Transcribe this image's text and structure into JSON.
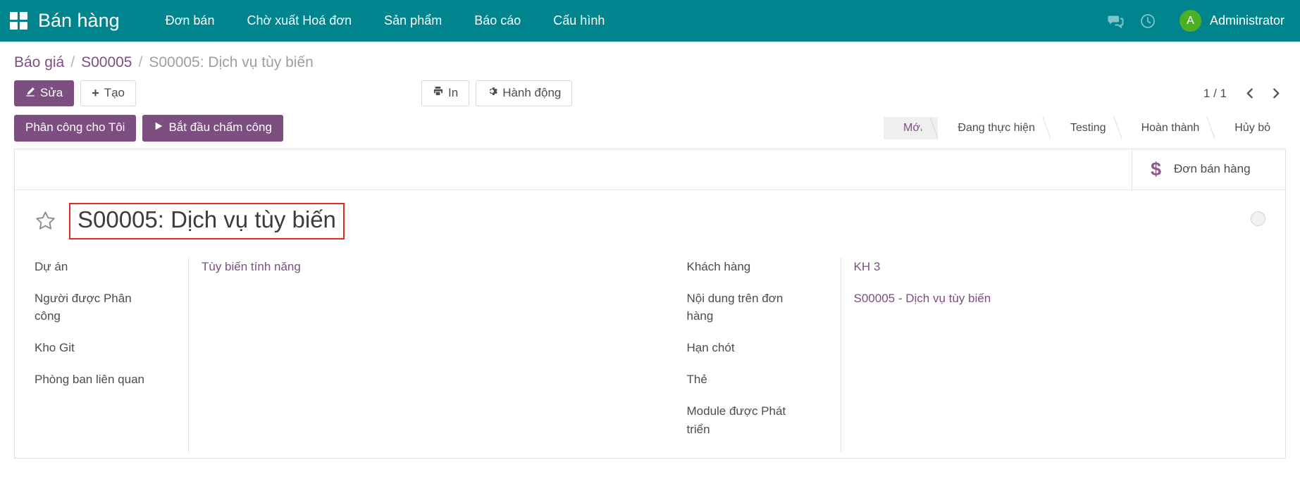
{
  "navbar": {
    "apps_icon": "apps-grid-icon",
    "brand": "Bán hàng",
    "menu": [
      {
        "label": "Đơn bán"
      },
      {
        "label": "Chờ xuất Hoá đơn"
      },
      {
        "label": "Sản phẩm"
      },
      {
        "label": "Báo cáo"
      },
      {
        "label": "Cấu hình"
      }
    ],
    "messages_icon": "chat-bubble-icon",
    "activity_icon": "clock-icon",
    "avatar_initial": "A",
    "user_name": "Administrator",
    "bg_color": "#00858f",
    "avatar_color": "#4caf24"
  },
  "breadcrumb": {
    "root": "Báo giá",
    "parent": "S00005",
    "current": "S00005: Dịch vụ tùy biến",
    "separator": "/"
  },
  "control_panel": {
    "edit_label": "Sửa",
    "edit_icon": "pencil-icon",
    "create_label": "Tạo",
    "create_icon": "plus-icon",
    "print_label": "In",
    "print_icon": "printer-icon",
    "action_label": "Hành động",
    "action_icon": "gear-icon",
    "pager_value": "1 / 1",
    "pager_prev_icon": "chevron-left-icon",
    "pager_next_icon": "chevron-right-icon"
  },
  "actions": {
    "assign_label": "Phân công cho Tôi",
    "timer_label": "Bắt đầu chấm công",
    "timer_icon": "play-icon",
    "accent_color": "#7d4e80"
  },
  "statusbar": {
    "active": "Mới",
    "stages": [
      {
        "label": "Mới",
        "active": true
      },
      {
        "label": "Đang thực hiện",
        "active": false
      },
      {
        "label": "Testing",
        "active": false
      },
      {
        "label": "Hoàn thành",
        "active": false
      },
      {
        "label": "Hủy bỏ",
        "active": false
      }
    ]
  },
  "sheet": {
    "smart_button": {
      "icon": "dollar-icon",
      "label": "Đơn bán hàng"
    },
    "star_icon": "star-outline-icon",
    "title": "S00005: Dịch vụ tùy biến",
    "title_highlight_color": "#e02b20",
    "kanban_state_icon": "kanban-state-circle-icon",
    "left_fields": [
      {
        "label": "Dự án",
        "value": "Tùy biến tính năng",
        "is_link": true
      },
      {
        "label": "Người được Phân công",
        "value": "",
        "is_link": false
      },
      {
        "label": "Kho Git",
        "value": "",
        "is_link": false
      },
      {
        "label": "Phòng ban liên quan",
        "value": "",
        "is_link": false
      }
    ],
    "right_fields": [
      {
        "label": "Khách hàng",
        "value": "KH 3",
        "is_link": true
      },
      {
        "label": "Nội dung trên đơn hàng",
        "value": "S00005 - Dịch vụ tùy biến",
        "is_link": true
      },
      {
        "label": "Hạn chót",
        "value": "",
        "is_link": false
      },
      {
        "label": "Thẻ",
        "value": "",
        "is_link": false
      },
      {
        "label": "Module được Phát triển",
        "value": "",
        "is_link": false
      }
    ]
  }
}
